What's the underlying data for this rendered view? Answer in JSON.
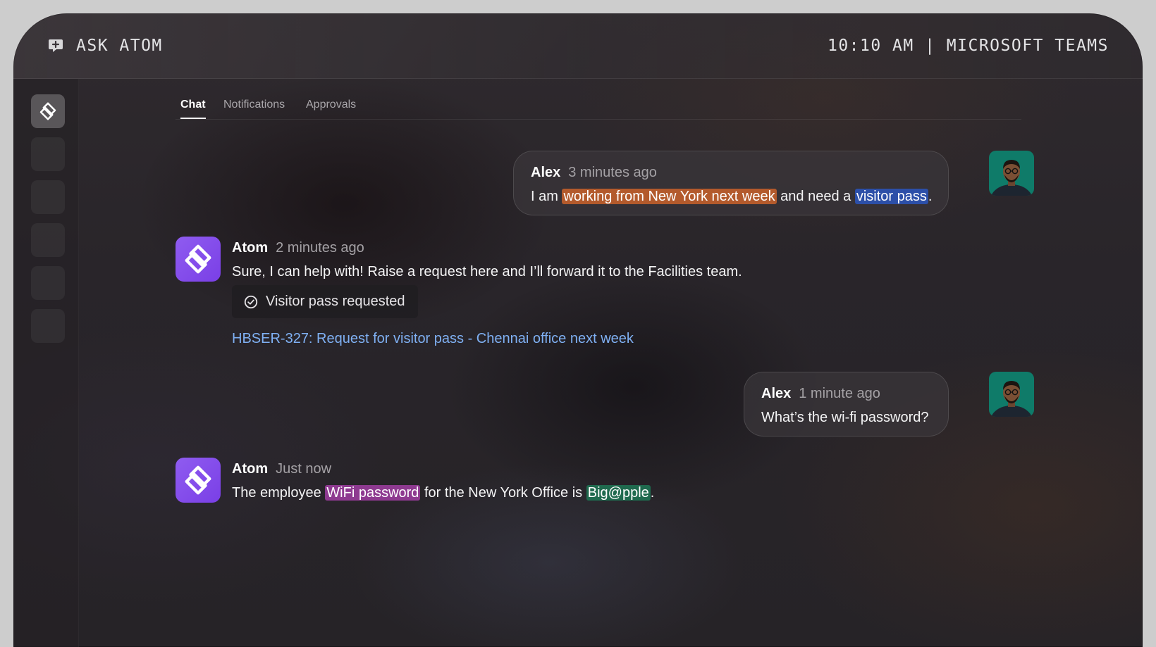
{
  "header": {
    "app_name": "ASK ATOM",
    "clock": "10:10 AM | MICROSOFT TEAMS",
    "app_icon": "chat-bubble-plus-icon"
  },
  "sidebar": {
    "items": [
      {
        "icon": "atom-logo-icon",
        "active": true
      },
      {
        "icon": "placeholder"
      },
      {
        "icon": "placeholder"
      },
      {
        "icon": "placeholder"
      },
      {
        "icon": "placeholder"
      },
      {
        "icon": "placeholder"
      }
    ]
  },
  "tabs": [
    {
      "label": "Chat",
      "active": true
    },
    {
      "label": "Notifications",
      "active": false
    },
    {
      "label": "Approvals",
      "active": false
    }
  ],
  "messages": [
    {
      "author": "Alex",
      "time": "3 minutes ago",
      "parts": [
        "I am ",
        "working from New York next week",
        " and need a ",
        "visitor pass",
        "."
      ]
    },
    {
      "author": "Atom",
      "time": "2 minutes ago",
      "text": "Sure, I can help with! Raise a request here and I’ll forward it to the Facilities team.",
      "status_chip": "Visitor pass requested",
      "link": "HBSER-327: Request for visitor pass - Chennai office next week"
    },
    {
      "author": "Alex",
      "time": "1 minute ago",
      "text": "What’s the wi-fi password?"
    },
    {
      "author": "Atom",
      "time": "Just now",
      "parts": [
        "The employee ",
        "WiFi password",
        " for the New York Office is ",
        "Big@pple",
        "."
      ]
    }
  ],
  "colors": {
    "atom_accent": "#8f5cf0",
    "link": "#7fb0f3",
    "highlight_location": "#b35a2c",
    "highlight_item": "#2c4fa8",
    "highlight_subject": "#8e3a90",
    "highlight_value": "#1f6a4e"
  }
}
